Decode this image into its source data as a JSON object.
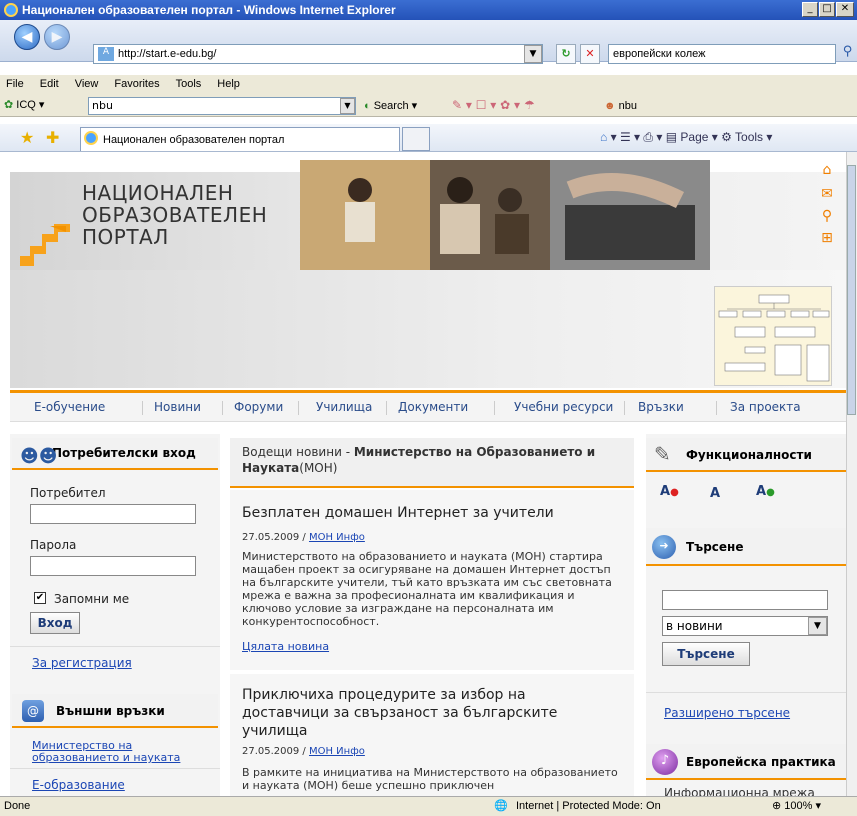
{
  "window": {
    "title": "Национален образователен портал - Windows Internet Explorer",
    "min": "_",
    "max": "□",
    "close": "✕"
  },
  "address": {
    "url": "http://start.e-edu.bg/",
    "search_value": "европейски колеж"
  },
  "menu": [
    "File",
    "Edit",
    "View",
    "Favorites",
    "Tools",
    "Help"
  ],
  "icq": {
    "label": "ICQ",
    "input_value": "nbu",
    "search_label": "Search",
    "nbu_label": "nbu"
  },
  "tab": {
    "title": "Национален образователен портал",
    "page_label": "Page",
    "tools_label": "Tools"
  },
  "status": {
    "left": "Done",
    "zone": "Internet | Protected Mode: On",
    "zoom": "100%"
  },
  "site": {
    "logo": [
      "НАЦИОНАЛЕН",
      "ОБРАЗОВАТЕЛЕН",
      "ПОРТАЛ"
    ],
    "nav": [
      "Е-обучение",
      "Новини",
      "Форуми",
      "Училища",
      "Документи",
      "Учебни ресурси",
      "Връзки",
      "За проекта"
    ],
    "login": {
      "title": "Потребителски вход",
      "user_label": "Потребител",
      "pass_label": "Парола",
      "remember_label": "Запомни ме",
      "submit": "Вход",
      "register": "За регистрация"
    },
    "external": {
      "title": "Външни връзки",
      "links": [
        "Министерство на образованието и науката",
        "Е-образование"
      ]
    },
    "news": {
      "header_prefix": "Водещи новини - ",
      "header_bold": "Министерство на Образованието и Науката",
      "header_suffix": "(МОН)",
      "items": [
        {
          "title": "Безплатен домашен Интернет за учители",
          "date": "27.05.2009 / ",
          "source": "МОН Инфо",
          "body": "Министерството на образованието и науката (МОН) стартира мащабен проект за осигуряване на домашен Интернет достъп на българските учители, тъй като връзката им със световната мрежа е важна за професионалната им квалификация и ключово условие за изграждане на персоналната им конкурентоспособност.",
          "more": "Цялата новина"
        },
        {
          "title": "Приключиха процедурите за избор на доставчици за свързаност за българските училища",
          "date": "27.05.2009 / ",
          "source": "МОН Инфо",
          "body": "В рамките на инициатива на Министерството на образованието и науката (МОН) беше успешно приключен"
        }
      ]
    },
    "features": {
      "title": "Функционалности",
      "a_small": "A",
      "a_normal": "A",
      "a_large": "A"
    },
    "search": {
      "title": "Търсене",
      "select_value": "в новини",
      "submit": "Търсене",
      "advanced": "Разширено търсене"
    },
    "european": {
      "title": "Европейска практика",
      "sub": "Информационна мрежа"
    }
  },
  "colors": {
    "accent": "#f39200",
    "link": "#1b46b4",
    "titlebar": "#2452b8"
  }
}
